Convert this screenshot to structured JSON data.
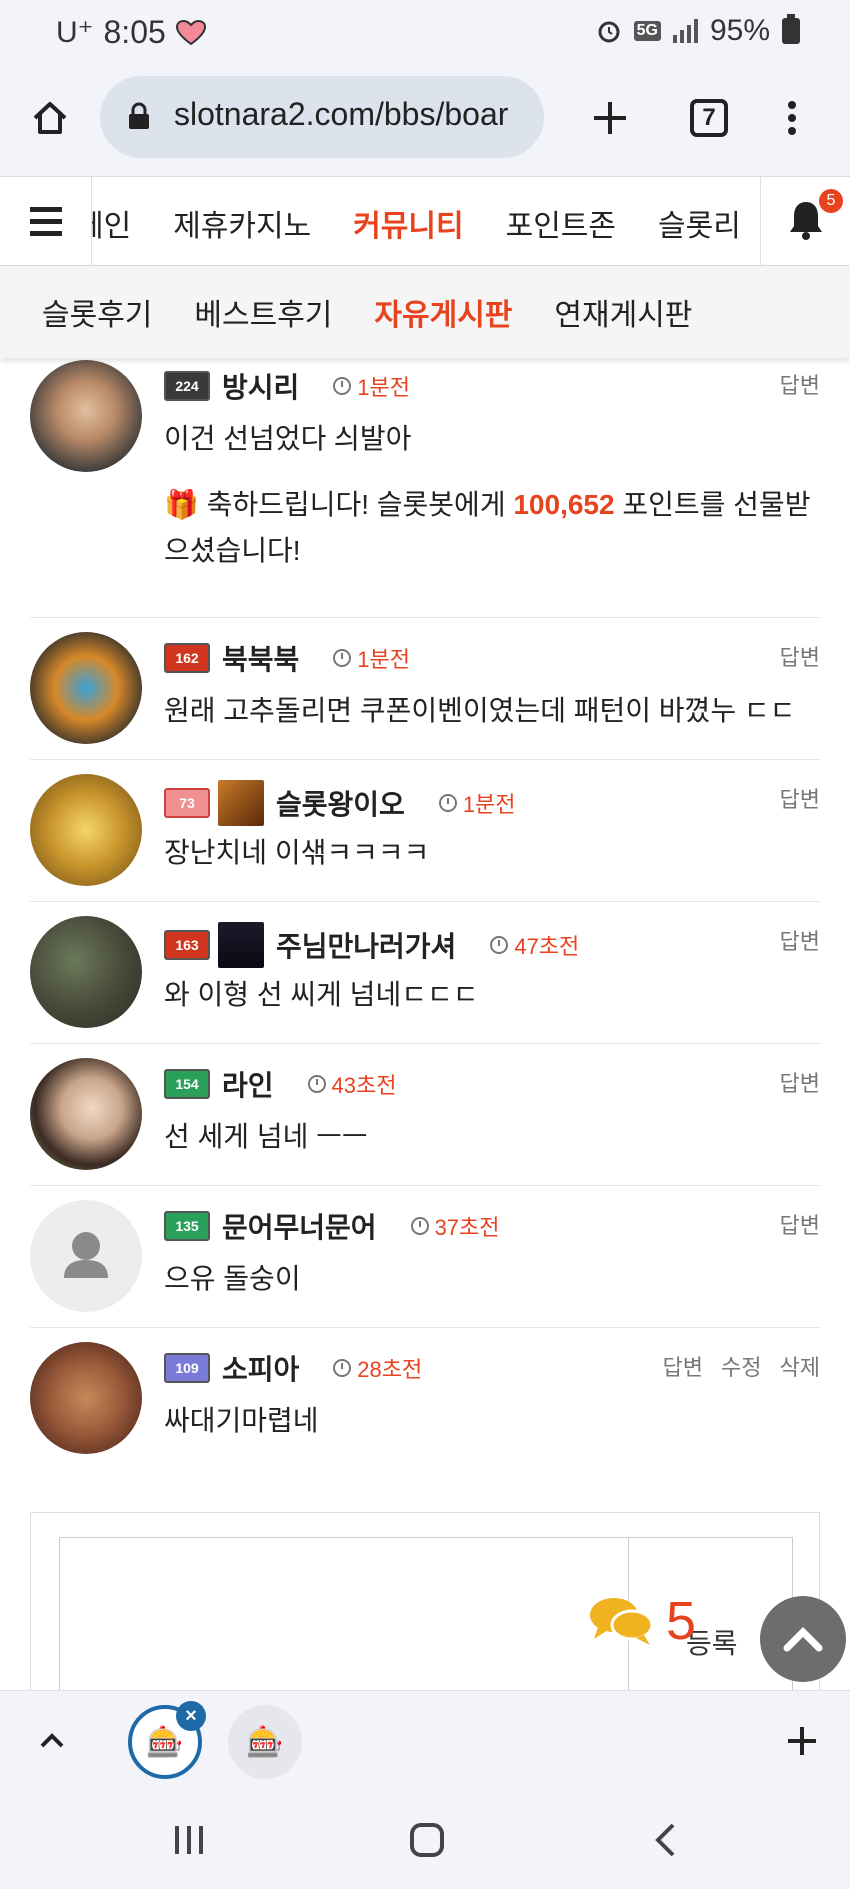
{
  "status": {
    "carrier": "U⁺",
    "time": "8:05",
    "network": "5G",
    "battery": "95%"
  },
  "browser": {
    "url": "slotnara2.com/bbs/boar",
    "tab_count": "7"
  },
  "site_nav": {
    "items": [
      "메인",
      "제휴카지노",
      "커뮤니티",
      "포인트존",
      "슬롯리"
    ],
    "active": "커뮤니티",
    "notification_count": "5"
  },
  "sub_nav": {
    "items": [
      "슬롯후기",
      "베스트후기",
      "자유게시판",
      "연재게시판"
    ],
    "active": "자유게시판"
  },
  "comments": [
    {
      "level": "224",
      "nick": "방시리",
      "time": "1분전",
      "text": "이건 선넘었다 싀발아",
      "gift": {
        "prefix": "축하드립니다! 슬롯봇에게 ",
        "points": "100,652",
        "suffix": " 포인트를 선물받으셨습니다!"
      },
      "actions": [
        "답변"
      ]
    },
    {
      "level": "162",
      "nick": "북북북",
      "time": "1분전",
      "text": "원래 고추돌리면 쿠폰이벤이였는데 패턴이 바꼈누 ㄷㄷ",
      "actions": [
        "답변"
      ]
    },
    {
      "level": "73",
      "nick": "슬롯왕이오",
      "time": "1분전",
      "text": "장난치네 이샊ㅋㅋㅋㅋ",
      "actions": [
        "답변"
      ]
    },
    {
      "level": "163",
      "nick": "주님만나러가셔",
      "time": "47초전",
      "text": "와 이형 선 씨게 넘네ㄷㄷㄷ",
      "actions": [
        "답변"
      ]
    },
    {
      "level": "154",
      "nick": "라인",
      "time": "43초전",
      "text": "선 세게  넘네 ㅡㅡ",
      "actions": [
        "답변"
      ]
    },
    {
      "level": "135",
      "nick": "문어무너문어",
      "time": "37초전",
      "text": "으유 돌숭이",
      "actions": [
        "답변"
      ]
    },
    {
      "level": "109",
      "nick": "소피아",
      "time": "28초전",
      "text": "싸대기마렵네",
      "actions": [
        "답변",
        "수정",
        "삭제"
      ]
    }
  ],
  "reply": {
    "submit_label": "등록",
    "chat_count": "5"
  },
  "colors": {
    "accent": "#e8431f",
    "tab_ring": "#1e6aa8"
  }
}
